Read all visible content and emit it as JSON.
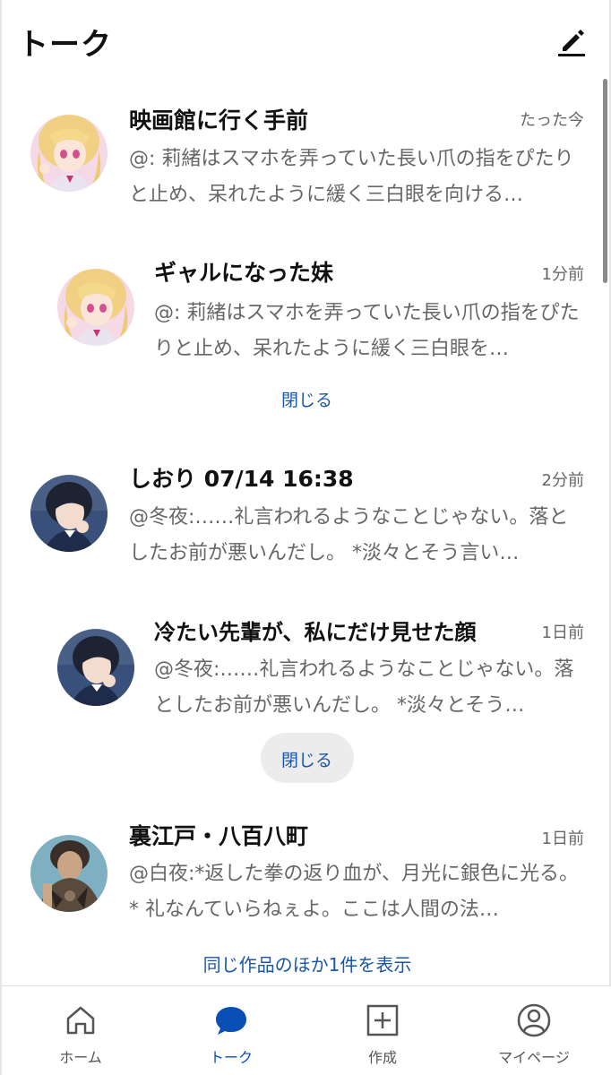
{
  "header": {
    "title": "トーク",
    "compose_icon": "pencil-icon"
  },
  "conversations": [
    {
      "title": "映画館に行く手前",
      "time": "たった今",
      "preview": "@: 莉緒はスマホを弄っていた長い爪の指をぴたりと止め、呆れたように緩く三白眼を向ける…",
      "avatar": "blonde-girl-avatar"
    },
    {
      "title": "ギャルになった妹",
      "time": "1分前",
      "preview": "@: 莉緒はスマホを弄っていた長い爪の指をぴたりと止め、呆れたように緩く三白眼を…",
      "avatar": "blonde-girl-avatar"
    },
    {
      "title": "しおり 07/14 16:38",
      "time": "2分前",
      "preview": "@冬夜:……礼言われるようなことじゃない。落としたお前が悪いんだし。 *淡々とそう言い…",
      "avatar": "dark-hair-boy-avatar"
    },
    {
      "title": "冷たい先輩が、私にだけ見せた顔",
      "time": "1日前",
      "preview": "@冬夜:……礼言われるようなことじゃない。落としたお前が悪いんだし。 *淡々とそう…",
      "avatar": "dark-hair-boy-avatar"
    },
    {
      "title": "裏江戸・八百八町",
      "time": "1日前",
      "preview": "@白夜:*返した拳の返り血が、月光に銀色に光る。* 礼なんていらねぇよ。ここは人間の法…",
      "avatar": "tattooed-man-avatar"
    }
  ],
  "close_label_1": "閉じる",
  "close_label_2": "閉じる",
  "more_label": "同じ作品のほか1件を表示",
  "nav": [
    {
      "label": "ホーム",
      "icon": "home-icon",
      "active": false
    },
    {
      "label": "トーク",
      "icon": "chat-bubble-icon",
      "active": true
    },
    {
      "label": "作成",
      "icon": "plus-square-icon",
      "active": false
    },
    {
      "label": "マイページ",
      "icon": "user-circle-icon",
      "active": false
    }
  ],
  "colors": {
    "accent": "#0a4fb5",
    "link": "#1b56a8",
    "text_secondary": "#666666"
  }
}
